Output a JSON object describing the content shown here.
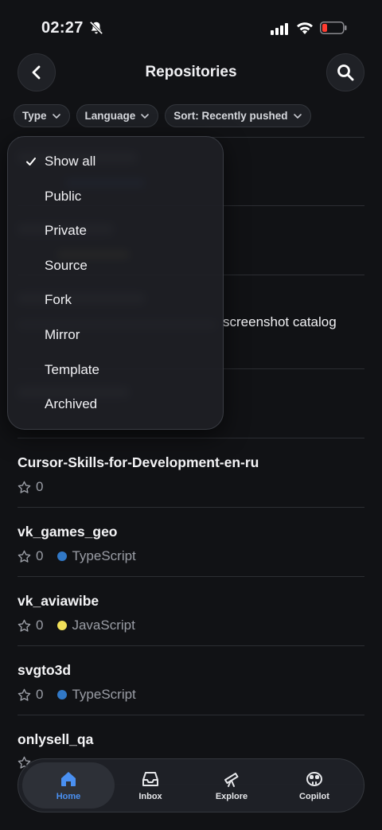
{
  "status_bar": {
    "time": "02:27"
  },
  "header": {
    "title": "Repositories"
  },
  "filters": {
    "type_label": "Type",
    "language_label": "Language",
    "sort_label": "Sort: Recently pushed"
  },
  "dropdown": {
    "selected": "Show all",
    "items": [
      "Show all",
      "Public",
      "Private",
      "Source",
      "Fork",
      "Mirror",
      "Template",
      "Archived"
    ]
  },
  "behind_menu_text": "screenshot catalog",
  "repos": [
    {
      "name": "Cursor-Skills-for-Development-en-ru",
      "stars": "0",
      "language": "",
      "lang_color": ""
    },
    {
      "name": "vk_games_geo",
      "stars": "0",
      "language": "TypeScript",
      "lang_color": "#3178c6"
    },
    {
      "name": "vk_aviawibe",
      "stars": "0",
      "language": "JavaScript",
      "lang_color": "#f1e05a"
    },
    {
      "name": "svgto3d",
      "stars": "0",
      "language": "TypeScript",
      "lang_color": "#3178c6"
    },
    {
      "name": "onlysell_qa",
      "stars": "",
      "language": "",
      "lang_color": ""
    }
  ],
  "tabbar": {
    "home": "Home",
    "inbox": "Inbox",
    "explore": "Explore",
    "copilot": "Copilot"
  },
  "colors": {
    "accent": "#4a90f2",
    "background": "#111215"
  }
}
